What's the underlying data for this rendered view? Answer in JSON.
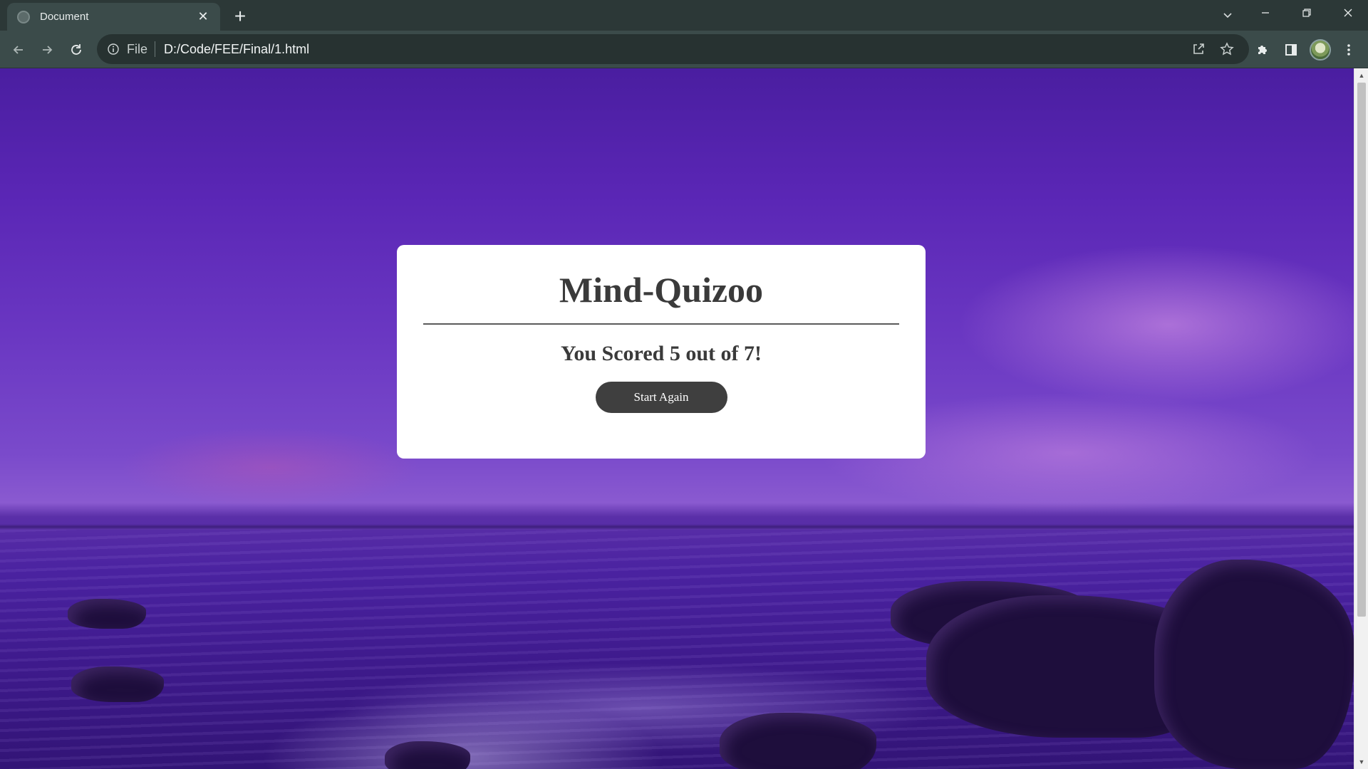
{
  "browser": {
    "tab": {
      "title": "Document",
      "favicon": "globe-icon",
      "close_glyph": "✕"
    },
    "new_tab_glyph": "+",
    "address": {
      "scheme_label": "File",
      "url": "D:/Code/FEE/Final/1.html"
    },
    "icons": {
      "back": "arrow-left-icon",
      "forward": "arrow-right-icon",
      "reload": "reload-icon",
      "site_info": "info-icon",
      "share": "share-icon",
      "bookmark": "star-icon",
      "extensions": "puzzle-icon",
      "side_panel": "side-panel-icon",
      "profile": "avatar",
      "menu": "kebab-menu-icon"
    }
  },
  "page": {
    "title": "Mind-Quizoo",
    "score_text": "You Scored 5 out of 7!",
    "restart_label": "Start Again"
  },
  "colors": {
    "card_bg": "#ffffff",
    "text": "#3a3a3a",
    "button_bg": "#3f3f3f",
    "chrome_bg": "#3b4b4a"
  }
}
